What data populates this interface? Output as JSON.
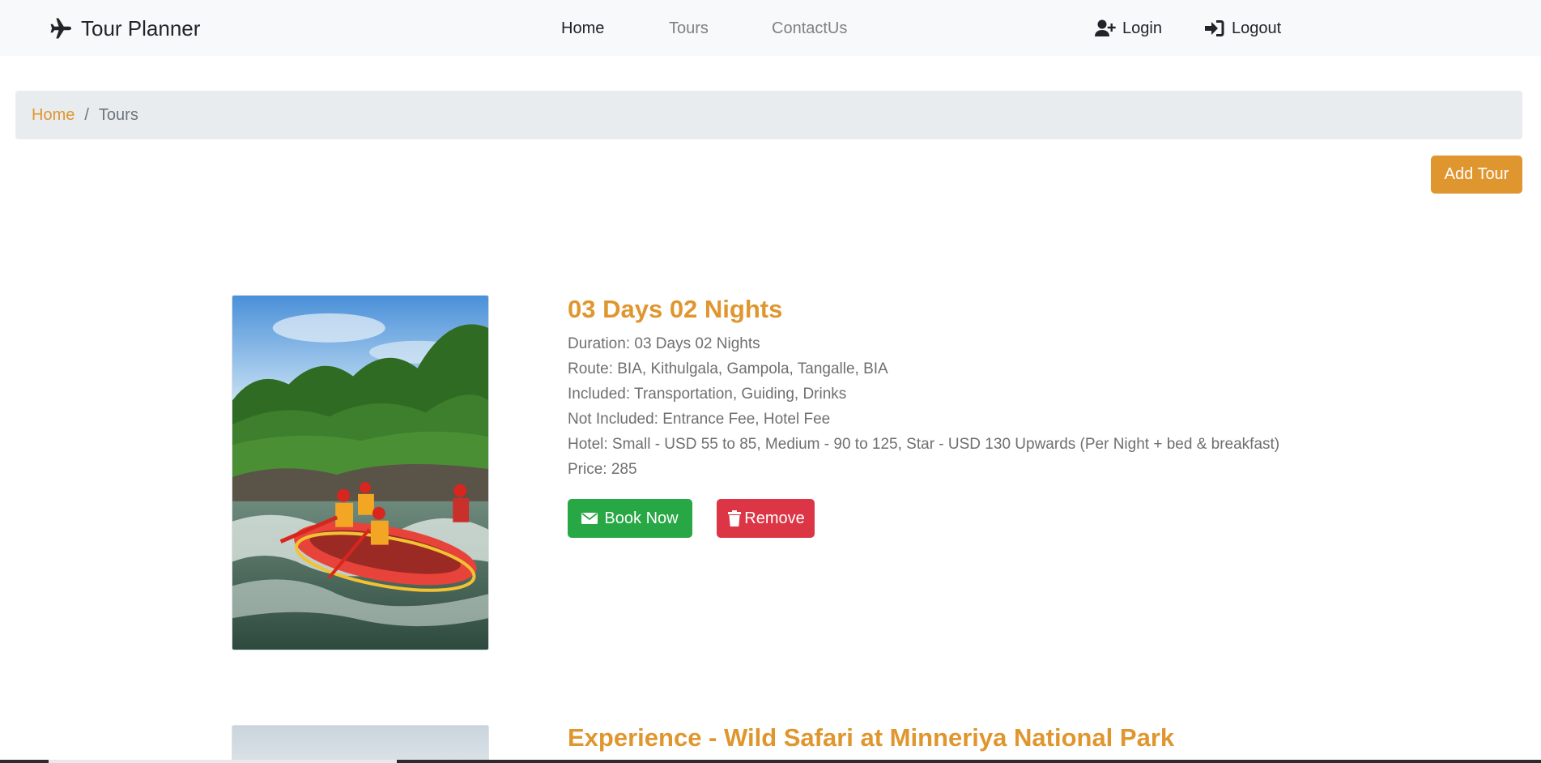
{
  "navbar": {
    "brand": "Tour Planner",
    "links": [
      {
        "label": "Home"
      },
      {
        "label": "Tours"
      },
      {
        "label": "ContactUs"
      }
    ],
    "login_label": "Login",
    "logout_label": "Logout"
  },
  "breadcrumb": {
    "home": "Home",
    "separator": "/",
    "current": "Tours"
  },
  "add_tour_label": "Add Tour",
  "tours": [
    {
      "title": "03 Days 02 Nights",
      "duration": "Duration: 03 Days 02 Nights",
      "route": "Route: BIA, Kithulgala, Gampola, Tangalle, BIA",
      "included": "Included: Transportation, Guiding, Drinks",
      "not_included": "Not Included: Entrance Fee, Hotel Fee",
      "hotel": "Hotel: Small - USD 55 to 85, Medium - 90 to 125, Star - USD 130 Upwards (Per Night + bed & breakfast)",
      "price": "Price: 285",
      "book_label": "Book Now",
      "remove_label": "Remove"
    },
    {
      "title": "Experience - Wild Safari at Minneriya National Park"
    }
  ],
  "colors": {
    "accent": "#e0962e",
    "book": "#28a745",
    "remove": "#dc3545",
    "navbar_bg": "#f8f9fa",
    "breadcrumb_bg": "#e9ecef"
  },
  "icons": {
    "brand": "plane-icon",
    "login": "user-plus-icon",
    "logout": "sign-in-icon",
    "book": "envelope-icon",
    "remove": "trash-icon"
  }
}
